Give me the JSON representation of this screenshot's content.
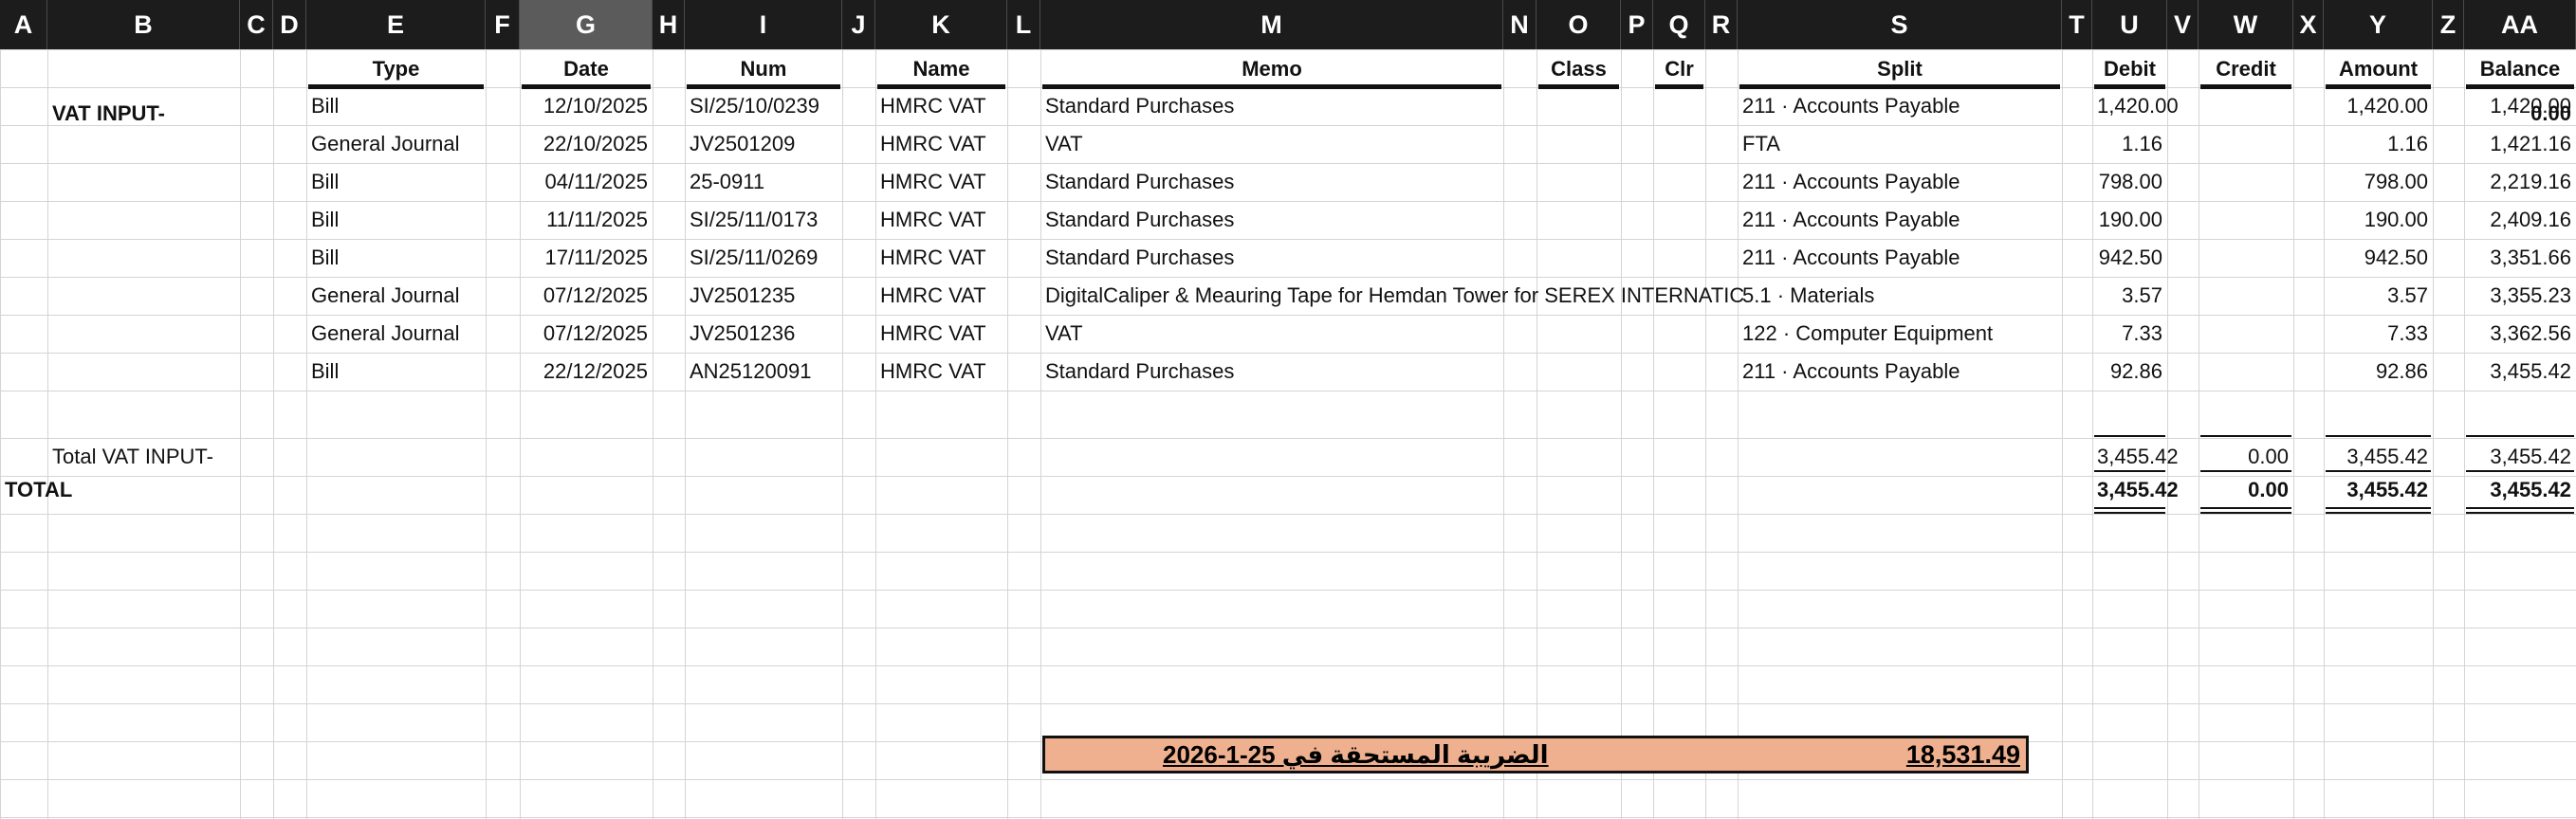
{
  "columns": [
    "A",
    "B",
    "C",
    "D",
    "E",
    "F",
    "G",
    "H",
    "I",
    "J",
    "K",
    "L",
    "M",
    "N",
    "O",
    "P",
    "Q",
    "R",
    "S",
    "T",
    "U",
    "V",
    "W",
    "X",
    "Y",
    "Z",
    "AA"
  ],
  "selected_column": "G",
  "headers": {
    "type": "Type",
    "date": "Date",
    "num": "Num",
    "name": "Name",
    "memo": "Memo",
    "class": "Class",
    "clr": "Clr",
    "split": "Split",
    "debit": "Debit",
    "credit": "Credit",
    "amount": "Amount",
    "balance": "Balance"
  },
  "section": {
    "title": "VAT INPUT-",
    "opening_balance": "0.00"
  },
  "rows": [
    {
      "type": "Bill",
      "date": "12/10/2025",
      "num": "SI/25/10/0239",
      "name": "HMRC VAT",
      "memo": "Standard Purchases",
      "split": "211 · Accounts Payable",
      "debit": "1,420.00",
      "amount": "1,420.00",
      "balance": "1,420.00"
    },
    {
      "type": "General Journal",
      "date": "22/10/2025",
      "num": "JV2501209",
      "name": "HMRC VAT",
      "memo": "VAT",
      "split": "FTA",
      "debit": "1.16",
      "amount": "1.16",
      "balance": "1,421.16"
    },
    {
      "type": "Bill",
      "date": "04/11/2025",
      "num": "25-0911",
      "name": "HMRC VAT",
      "memo": "Standard Purchases",
      "split": "211 · Accounts Payable",
      "debit": "798.00",
      "amount": "798.00",
      "balance": "2,219.16"
    },
    {
      "type": "Bill",
      "date": "11/11/2025",
      "num": "SI/25/11/0173",
      "name": "HMRC VAT",
      "memo": "Standard Purchases",
      "split": "211 · Accounts Payable",
      "debit": "190.00",
      "amount": "190.00",
      "balance": "2,409.16"
    },
    {
      "type": "Bill",
      "date": "17/11/2025",
      "num": "SI/25/11/0269",
      "name": "HMRC VAT",
      "memo": "Standard Purchases",
      "split": "211 · Accounts Payable",
      "debit": "942.50",
      "amount": "942.50",
      "balance": "3,351.66"
    },
    {
      "type": "General Journal",
      "date": "07/12/2025",
      "num": "JV2501235",
      "name": "HMRC VAT",
      "memo": "DigitalCaliper & Meauring Tape for Hemdan Tower for SEREX INTERNATIC",
      "split": "5.1 · Materials",
      "debit": "3.57",
      "amount": "3.57",
      "balance": "3,355.23"
    },
    {
      "type": "General Journal",
      "date": "07/12/2025",
      "num": "JV2501236",
      "name": "HMRC VAT",
      "memo": "VAT",
      "split": "122 · Computer Equipment",
      "debit": "7.33",
      "amount": "7.33",
      "balance": "3,362.56"
    },
    {
      "type": "Bill",
      "date": "22/12/2025",
      "num": "AN25120091",
      "name": "HMRC VAT",
      "memo": "Standard Purchases",
      "split": "211 · Accounts Payable",
      "debit": "92.86",
      "amount": "92.86",
      "balance": "3,455.42"
    }
  ],
  "subtotal": {
    "label": "Total VAT INPUT-",
    "debit": "3,455.42",
    "credit": "0.00",
    "amount": "3,455.42",
    "balance": "3,455.42"
  },
  "total": {
    "label": "TOTAL",
    "debit": "3,455.42",
    "credit": "0.00",
    "amount": "3,455.42",
    "balance": "3,455.42"
  },
  "vat_due": {
    "label": "الضريبة المستحقة في 25-1-2026",
    "amount": "18,531.49",
    "fill_color": "#eeb08e"
  }
}
